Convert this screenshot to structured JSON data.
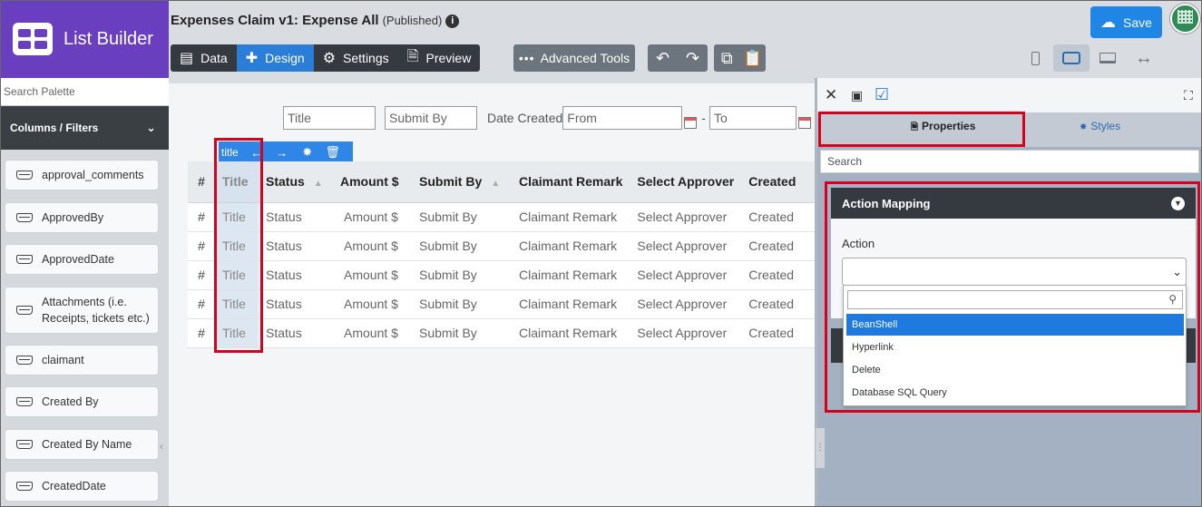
{
  "app": {
    "title": "List Builder"
  },
  "page": {
    "title": "Expenses Claim v1: Expense All",
    "status": "(Published)"
  },
  "toolbar": {
    "data": "Data",
    "design": "Design",
    "settings": "Settings",
    "preview": "Preview",
    "advanced": "Advanced Tools",
    "save": "Save"
  },
  "palette": {
    "search_placeholder": "Search Palette",
    "section": "Columns / Filters",
    "items": [
      "approval_comments",
      "ApprovedBy",
      "ApprovedDate",
      "Attachments (i.e. Receipts, tickets etc.)",
      "claimant",
      "Created By",
      "Created By Name",
      "CreatedDate"
    ]
  },
  "filters": {
    "title_placeholder": "Title",
    "submit_placeholder": "Submit By",
    "date_label": "Date Created",
    "from_placeholder": "From",
    "sep": "-",
    "to_placeholder": "To"
  },
  "column_toolbar": {
    "label": "title"
  },
  "table": {
    "headers": [
      "#",
      "Title",
      "Status",
      "Amount $",
      "Submit By",
      "Claimant Remark",
      "Select Approver",
      "Created"
    ],
    "rows": [
      [
        "#",
        "Title",
        "Status",
        "Amount $",
        "Submit By",
        "Claimant Remark",
        "Select Approver",
        "Created"
      ],
      [
        "#",
        "Title",
        "Status",
        "Amount $",
        "Submit By",
        "Claimant Remark",
        "Select Approver",
        "Created"
      ],
      [
        "#",
        "Title",
        "Status",
        "Amount $",
        "Submit By",
        "Claimant Remark",
        "Select Approver",
        "Created"
      ],
      [
        "#",
        "Title",
        "Status",
        "Amount $",
        "Submit By",
        "Claimant Remark",
        "Select Approver",
        "Created"
      ],
      [
        "#",
        "Title",
        "Status",
        "Amount $",
        "Submit By",
        "Claimant Remark",
        "Select Approver",
        "Created"
      ]
    ]
  },
  "properties": {
    "tab_properties": "Properties",
    "tab_styles": "Styles",
    "search_placeholder": "Search",
    "section": "Action Mapping",
    "action_label": "Action",
    "options": [
      "BeanShell",
      "Hyperlink",
      "Delete",
      "Database SQL Query"
    ]
  },
  "colors": {
    "brand": "#6a3fbf",
    "accent": "#1f86e5",
    "highlight": "#d8001c"
  }
}
